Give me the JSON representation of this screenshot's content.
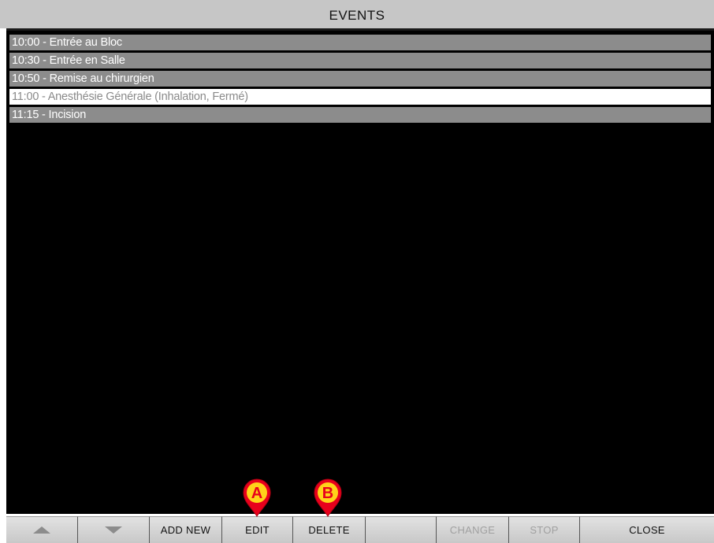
{
  "window": {
    "title": "EVENTS"
  },
  "events": [
    {
      "label": "10:00 - Entrée au Bloc",
      "selected": false
    },
    {
      "label": "10:30 - Entrée en Salle",
      "selected": false
    },
    {
      "label": "10:50 - Remise au chirurgien",
      "selected": false
    },
    {
      "label": "11:00 - Anesthésie Générale (Inhalation, Fermé)",
      "selected": true
    },
    {
      "label": "11:15 - Incision",
      "selected": false
    }
  ],
  "toolbar": {
    "up_icon": "triangle-up-icon",
    "down_icon": "triangle-down-icon",
    "add_new": "ADD NEW",
    "edit": "EDIT",
    "delete": "DELETE",
    "blank": "",
    "change": "CHANGE",
    "stop": "STOP",
    "close": "CLOSE"
  },
  "annotations": {
    "a": "A",
    "b": "B",
    "marker_color": "#e8001c",
    "marker_text_color": "#ffd21a"
  }
}
